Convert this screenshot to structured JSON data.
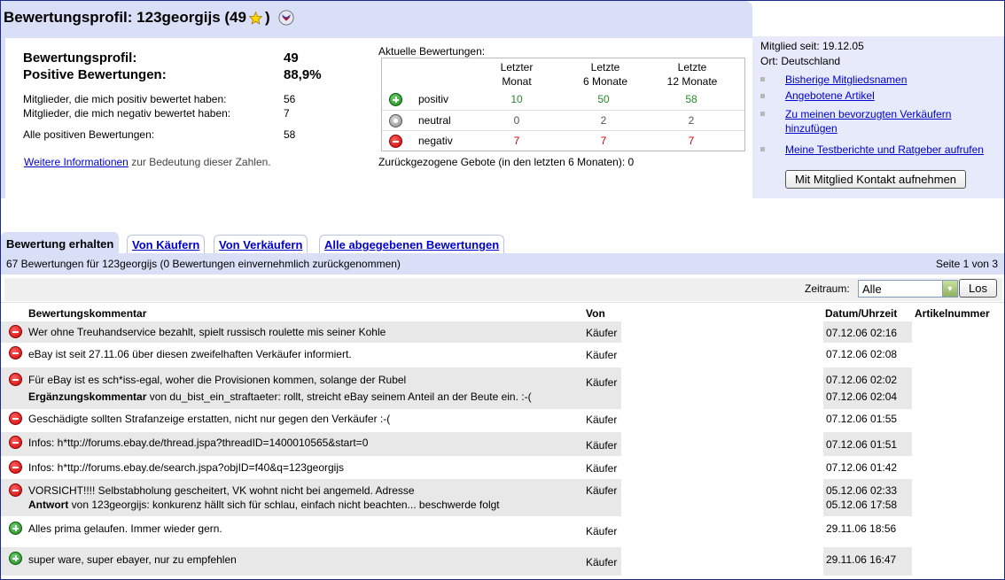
{
  "title": {
    "prefix": "Bewertungsprofil: 123georgijs (49",
    "suffix": ")",
    "icons": [
      "star-icon",
      "shield-icon"
    ]
  },
  "summary": {
    "profile_label": "Bewertungsprofil:",
    "profile_value": "49",
    "positive_label": "Positive Bewertungen:",
    "positive_value": "88,9%",
    "members_positive_label": "Mitglieder, die mich positiv bewertet haben:",
    "members_positive_value": "56",
    "members_negative_label": "Mitglieder, die mich negativ bewertet haben:",
    "members_negative_value": "7",
    "all_positive_label": "Alle positiven Bewertungen:",
    "all_positive_value": "58",
    "more_info_link": "Weitere Informationen",
    "more_info_text": "zur Bedeutung dieser Zahlen."
  },
  "current_ratings": {
    "title": "Aktuelle Bewertungen:",
    "columns": [
      {
        "line1": "Letzter",
        "line2": "Monat"
      },
      {
        "line1": "Letzte",
        "line2": "6 Monate"
      },
      {
        "line1": "Letzte",
        "line2": "12 Monate"
      }
    ],
    "rows": [
      {
        "name": "positiv",
        "values": [
          "10",
          "50",
          "58"
        ]
      },
      {
        "name": "neutral",
        "values": [
          "0",
          "2",
          "2"
        ]
      },
      {
        "name": "negativ",
        "values": [
          "7",
          "7",
          "7"
        ]
      }
    ],
    "withdrawn": "Zurückgezogene Gebote (in den letzten 6 Monaten): 0"
  },
  "member": {
    "since": "Mitglied seit: 19.12.05",
    "location": "Ort: Deutschland",
    "links": [
      "Bisherige Mitgliedsnamen",
      "Angebotene Artikel",
      "Zu meinen bevorzugten Verkäufern",
      "hinzufügen",
      "Meine Testberichte und Ratgeber aufrufen"
    ],
    "contact_button": "Mit Mitglied Kontakt aufnehmen"
  },
  "tabs": [
    "Bewertung erhalten",
    "Von Käufern",
    "Von Verkäufern",
    "Alle abgegebenen Bewertungen"
  ],
  "info": {
    "count_text": "67 Bewertungen für 123georgijs (0 Bewertungen einvernehmlich zurückgenommen)",
    "page_text": "Seite 1 von 3"
  },
  "filter": {
    "label": "Zeitraum:",
    "selected": "Alle",
    "go_button": "Los"
  },
  "table": {
    "headers": [
      "Bewertungskommentar",
      "Von",
      "Datum/Uhrzeit",
      "Artikelnummer"
    ],
    "rows": [
      {
        "type": "neg",
        "comment": "Wer ohne Treuhandservice bezahlt, spielt russisch roulette mis seiner Kohle",
        "von": "Käufer",
        "date": "07.12.06 02:16"
      },
      {
        "type": "neg",
        "comment": "eBay ist seit 27.11.06 über diesen zweifelhaften Verkäufer informiert.",
        "von": "Käufer",
        "date": "07.12.06 02:08"
      },
      {
        "type": "neg",
        "comment": "Für eBay ist es sch*iss-egal, woher die Provisionen kommen, solange der Rubel",
        "von": "Käufer",
        "date": "07.12.06 02:02",
        "extra_bold": "Ergänzungskommentar",
        "extra_text": " von du_bist_ein_straftaeter: rollt, streicht eBay seinem Anteil an der Beute ein. :-(",
        "extra_date": "07.12.06 02:04"
      },
      {
        "type": "neg",
        "comment": "Geschädigte sollten Strafanzeige erstatten, nicht nur gegen den Verkäufer :-(",
        "von": "Käufer",
        "date": "07.12.06 01:55"
      },
      {
        "type": "neg",
        "comment": "Infos: h*ttp://forums.ebay.de/thread.jspa?threadID=1400010565&start=0",
        "von": "Käufer",
        "date": "07.12.06 01:51"
      },
      {
        "type": "neg",
        "comment": "Infos: h*ttp://forums.ebay.de/search.jspa?objID=f40&q=123georgijs",
        "von": "Käufer",
        "date": "07.12.06 01:42"
      },
      {
        "type": "neg",
        "comment": "VORSICHT!!!! Selbstabholung gescheitert, VK wohnt nicht bei angemeld. Adresse",
        "von": "Käufer",
        "date": "05.12.06 02:33",
        "extra_bold": "Antwort",
        "extra_text": " von 123georgijs: konkurenz hällt sich für schlau, einfach nicht beachten... beschwerde folgt",
        "extra_date": "05.12.06 17:58"
      },
      {
        "type": "pos",
        "comment": "Alles prima gelaufen. Immer wieder gern.",
        "von": "Käufer",
        "date": "29.11.06 18:56"
      },
      {
        "type": "pos",
        "comment": "super ware, super ebayer, nur zu empfehlen",
        "von": "Käufer",
        "date": "29.11.06 16:47"
      }
    ]
  },
  "colors": {
    "accent_bg": "#d8dff7",
    "link": "#0000cc",
    "positive": "#2a8a2a",
    "negative": "#cc0000"
  }
}
